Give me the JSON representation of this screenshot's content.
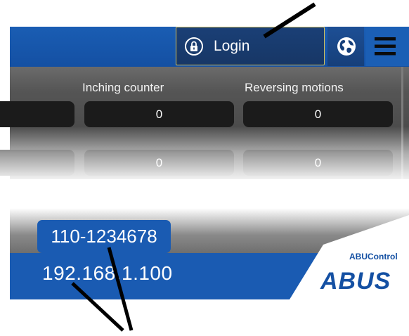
{
  "header": {
    "login_label": "Login",
    "icons": {
      "lock": "lock-icon",
      "globe": "globe-icon",
      "menu": "hamburger-menu-icon"
    }
  },
  "counters": {
    "columns": [
      "Inching counter",
      "Reversing motions"
    ],
    "rows": [
      {
        "inching": "0",
        "reversing": "0"
      },
      {
        "inching": "0",
        "reversing": "0"
      }
    ]
  },
  "device": {
    "serial_number": "110-1234678",
    "ip_address": "192.168.1.100"
  },
  "brand": {
    "product": "ABUControl",
    "logo": "ABUS"
  },
  "colors": {
    "header_blue": "#1a5bb2",
    "login_border": "#d9c45a",
    "panel_gray": "#4a4a4a",
    "value_box": "#1b1b1b"
  }
}
